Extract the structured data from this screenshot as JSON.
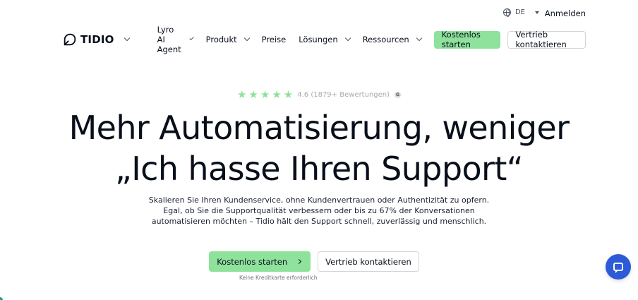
{
  "topbar": {
    "language": "DE",
    "login_label": "Anmelden"
  },
  "nav": {
    "logo_text": "TIDIO",
    "items": [
      {
        "label": "Lyro AI Agent",
        "has_dropdown": true
      },
      {
        "label": "Produkt",
        "has_dropdown": true
      },
      {
        "label": "Preise",
        "has_dropdown": false
      },
      {
        "label": "Lösungen",
        "has_dropdown": true
      },
      {
        "label": "Ressourcen",
        "has_dropdown": true
      }
    ],
    "cta_primary": "Kostenlos starten",
    "cta_secondary": "Vertrieb kontaktieren"
  },
  "hero": {
    "rating_text": "4.6 (1879+ Bewertungen)",
    "rating_value": 4.6,
    "rating_stars": 5,
    "headline_line1": "Mehr Automatisierung, weniger",
    "headline_line2": "„Ich hasse Ihren Support“",
    "subtext_line1": "Skalieren Sie Ihren Kundenservice, ohne Kundenvertrauen oder Authentizität zu opfern.",
    "subtext_line2": "Egal, ob Sie die Supportqualität verbessern oder bis zu 67% der Konversationen",
    "subtext_line3": "automatisieren möchten – Tidio hält den Support schnell, zuverlässig und menschlich.",
    "cta_primary": "Kostenlos starten",
    "cta_secondary": "Vertrieb kontaktieren",
    "note": "Keine Kreditkarte erforderlich"
  },
  "colors": {
    "accent_green": "#8ee29b",
    "chat_blue": "#2d5bd8",
    "text_dark": "#080f1a"
  },
  "icons": [
    "globe-icon",
    "caret-down-icon",
    "tidio-logo-icon",
    "chevron-down-icon",
    "star-icon",
    "g2-icon",
    "arrow-right-icon",
    "chat-icon"
  ]
}
